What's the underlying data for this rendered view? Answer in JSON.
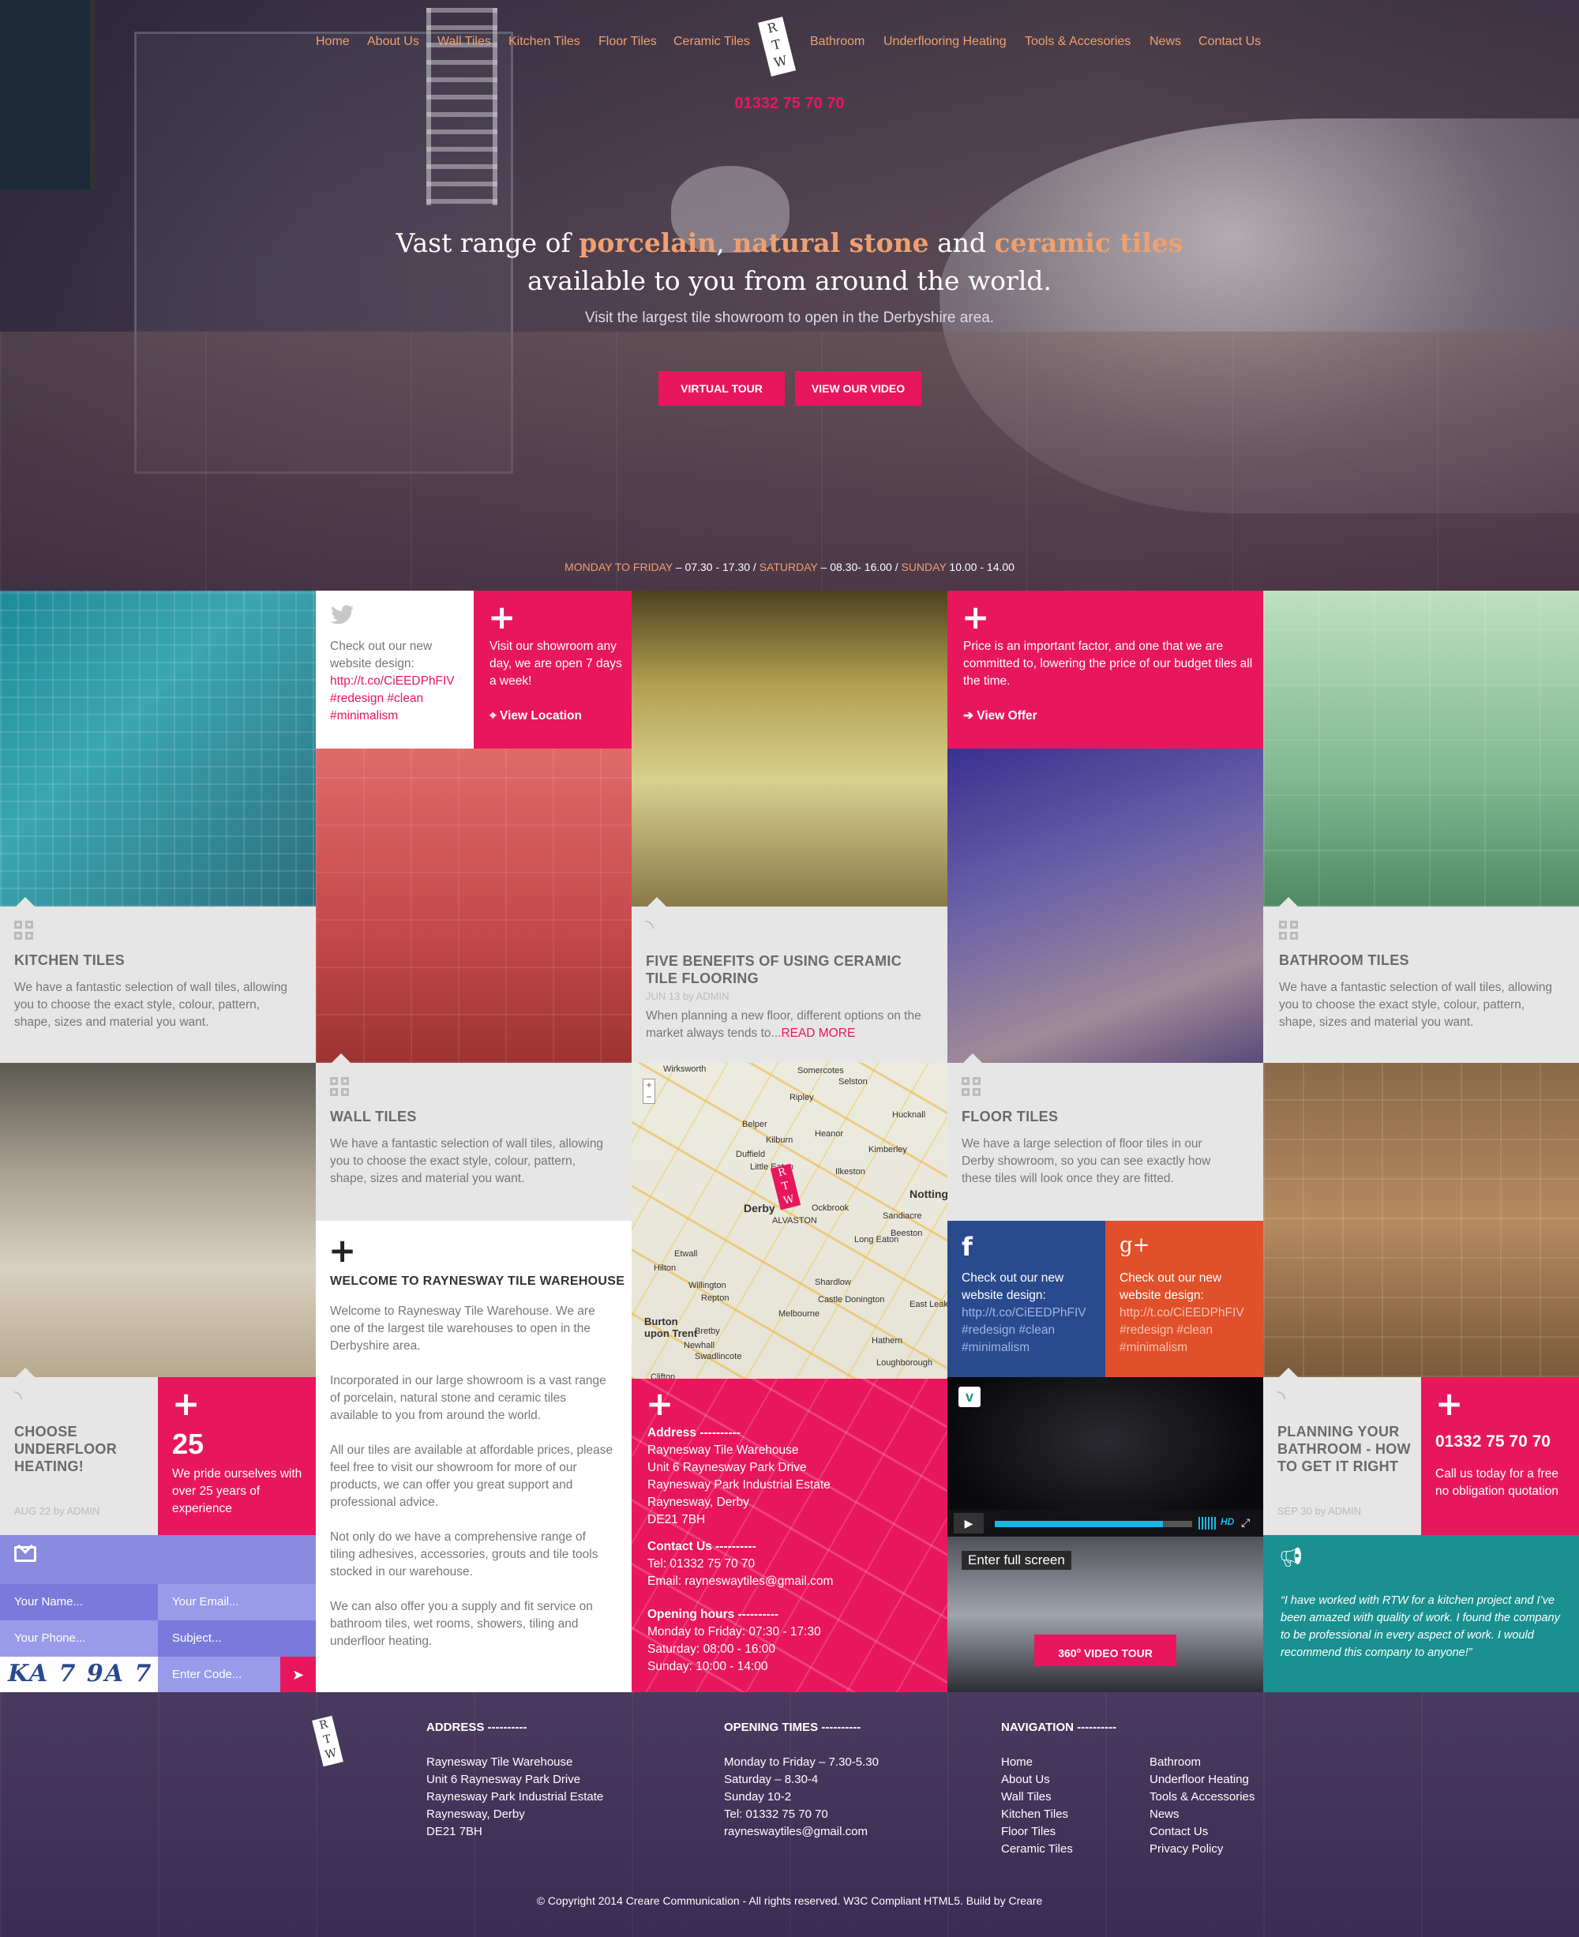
{
  "nav": {
    "items": [
      "Home",
      "About Us",
      "Wall Tiles",
      "Kitchen Tiles",
      "Floor Tiles",
      "Ceramic Tiles",
      "Bathroom",
      "Underflooring Heating",
      "Tools & Accesories",
      "News",
      "Contact Us"
    ],
    "logo": [
      "R",
      "T",
      "W"
    ]
  },
  "hero": {
    "phone": "01332 75 70 70",
    "title_part1": "Vast range of ",
    "title_hl1": "porcelain",
    "title_part2": ", ",
    "title_hl2": "natural stone",
    "title_part3": " and ",
    "title_hl3": "ceramic tiles",
    "title_line2": "available to you from around the world.",
    "subtitle": "Visit the largest tile showroom to open in the Derbyshire area.",
    "btn_tour": "VIRTUAL TOUR",
    "btn_video": "VIEW OUR VIDEO",
    "hours_d1": "MONDAY TO FRIDAY",
    "hours_t1": " – 07.30 - 17.30  /  ",
    "hours_d2": "SATURDAY",
    "hours_t2": " – 08.30- 16.00  /  ",
    "hours_d3": "SUNDAY",
    "hours_t3": " 10.00 - 14.00"
  },
  "tweet1": {
    "text": "Check out our new website design:",
    "link": "http://t.co/CiEEDPhFIV",
    "tags1": "#redesign #clean",
    "tags2": "#minimalism"
  },
  "showroom": {
    "text": "Visit our showroom any day, we are open 7 days a week!",
    "link": "View Location"
  },
  "offer": {
    "text": "Price is an important factor, and one that we are committed to, lowering the price of our budget tiles all the time.",
    "link": "View Offer"
  },
  "kitchen": {
    "title": "KITCHEN TILES",
    "text": "We have a fantastic selection of wall tiles, allowing you to choose the exact style, colour, pattern, shape, sizes and material you want."
  },
  "blog1": {
    "title": "FIVE BENEFITS OF USING CERAMIC TILE FLOORING",
    "meta": "JUN 13 by ADMIN",
    "text": "When planning a new floor, different options on the market always tends to...",
    "more": "READ MORE"
  },
  "bathroom": {
    "title": "BATHROOM TILES",
    "text": "We have a fantastic selection of wall tiles, allowing you to choose the exact style, colour, pattern, shape, sizes and material you want."
  },
  "wall": {
    "title": "WALL TILES",
    "text": "We have a fantastic selection of wall tiles, allowing you to choose the exact style, colour, pattern, shape, sizes and material you want."
  },
  "map": {
    "towns": [
      "Wirksworth",
      "Somercotes",
      "Selston",
      "Ripley",
      "Belper",
      "Heanor",
      "Hucknall",
      "Kilburn",
      "Duffield",
      "Little Eaton",
      "Kimberley",
      "Ilkeston",
      "Derby",
      "Ockbrook",
      "Nottingham",
      "Sandiacre",
      "Beeston",
      "ALVASTON",
      "Long Eaton",
      "Etwall",
      "Hilton",
      "Willington",
      "Repton",
      "Shardlow",
      "Castle Donington",
      "Melbourne",
      "East Leake",
      "Burton upon Trent",
      "Bretby",
      "Newhall",
      "Swadlincote",
      "Hathern",
      "Loughborough",
      "Clifton"
    ],
    "zoom_in": "+",
    "zoom_out": "−"
  },
  "floor": {
    "title": "FLOOR TILES",
    "text": "We have a large selection of floor tiles in our Derby showroom, so you can see exactly how these tiles will look once they are fitted."
  },
  "welcome": {
    "title": "WELCOME TO RAYNESWAY TILE WAREHOUSE",
    "p1": "Welcome to Raynesway Tile Warehouse. We are one of the largest tile warehouses to open in the Derbyshire area.",
    "p2": "Incorporated in our large showroom is a vast range of porcelain, natural stone and ceramic tiles available to you from around the world.",
    "p3": "All our tiles are available at affordable prices, please feel free to visit our showroom for more of our products, we can offer you great support and professional advice.",
    "p4": "Not only do we have a comprehensive range of tiling adhesives, accessories, grouts and tile tools stocked in our warehouse.",
    "p5": "We can also offer you a supply and fit service on bathroom tiles, wet rooms, showers, tiling and underfloor heating."
  },
  "fb": {
    "text": "Check out our new website design:",
    "link": "http://t.co/CiEEDPhFIV",
    "tags1": "#redesign #clean",
    "tags2": "#minimalism"
  },
  "gp": {
    "icon": "g+",
    "text": "Check out our new website design:",
    "link": "http://t.co/CiEEDPhFIV",
    "tags1": "#redesign #clean",
    "tags2": "#minimalism"
  },
  "underfloor": {
    "title": "CHOOSE UNDERFLOOR HEATING!",
    "meta": "AUG 22 by ADMIN"
  },
  "years": {
    "number": "25",
    "text": "We pride ourselves with over 25 years of experience"
  },
  "address_tile": {
    "addr_head": "Address ----------",
    "addr": [
      "Raynesway Tile Warehouse",
      "Unit 6 Raynesway Park Drive",
      "Raynesway Park Industrial Estate",
      "Raynesway, Derby",
      "DE21 7BH"
    ],
    "contact_head": "Contact Us ----------",
    "tel": "Tel: 01332 75 70 70",
    "email": "Email: rayneswaytiles@gmail.com",
    "hours_head": "Opening hours ----------",
    "hours": [
      "Monday to Friday: 07:30 - 17:30",
      "Saturday: 08:00 - 16:00",
      "Sunday: 10:00 - 14:00"
    ]
  },
  "video": {
    "hd": "HD",
    "progress": 0.85
  },
  "tour": {
    "tooltip": "Enter full screen",
    "btn_num": "360",
    "btn_sup": "o",
    "btn_text": " VIDEO TOUR"
  },
  "planning": {
    "title": "PLANNING YOUR BATHROOM - HOW TO GET IT RIGHT",
    "meta": "SEP 30 by ADMIN"
  },
  "call": {
    "phone": "01332 75 70 70",
    "text": "Call us today for a free no obligation quotation"
  },
  "testimonial": {
    "text": "“I have worked with RTW for a kitchen project and I’ve been amazed with quality of work. I found the company to be professional in every aspect of work. I would recommend this company to anyone!”"
  },
  "form": {
    "name": "Your Name...",
    "email": "Your Email...",
    "phone": "Your Phone...",
    "subject": "Subject...",
    "captcha": "KA 7 9A 7",
    "code": "Enter Code..."
  },
  "footer": {
    "address_head": "ADDRESS ----------",
    "address": [
      "Raynesway Tile Warehouse",
      "Unit 6 Raynesway Park Drive",
      "Raynesway Park Industrial Estate",
      "Raynesway, Derby",
      "DE21 7BH"
    ],
    "times_head": "OPENING TIMES ----------",
    "times": [
      "Monday to Friday – 7.30-5.30",
      "Saturday – 8.30-4",
      "Sunday 10-2",
      "Tel: 01332 75 70 70",
      "rayneswaytiles@gmail.com"
    ],
    "nav_head": "NAVIGATION ----------",
    "nav_col1": [
      "Home",
      "About Us",
      "Wall Tiles",
      "Kitchen Tiles",
      "Floor Tiles",
      "Ceramic Tiles"
    ],
    "nav_col2": [
      "Bathroom",
      "Underfloor Heating",
      "Tools & Accessories",
      "News",
      "Contact Us",
      "Privacy Policy"
    ],
    "copyright": "© Copyright 2014 Creare Communication - All rights reserved.  W3C Compliant HTML5.  Build by Creare"
  },
  "colors": {
    "accent_pink": "#e8175d",
    "accent_orange": "#f0a070",
    "facebook": "#2a4a8e",
    "gplus": "#e0502a",
    "teal": "#1a9090",
    "form_purple": "#8a8ae0"
  }
}
